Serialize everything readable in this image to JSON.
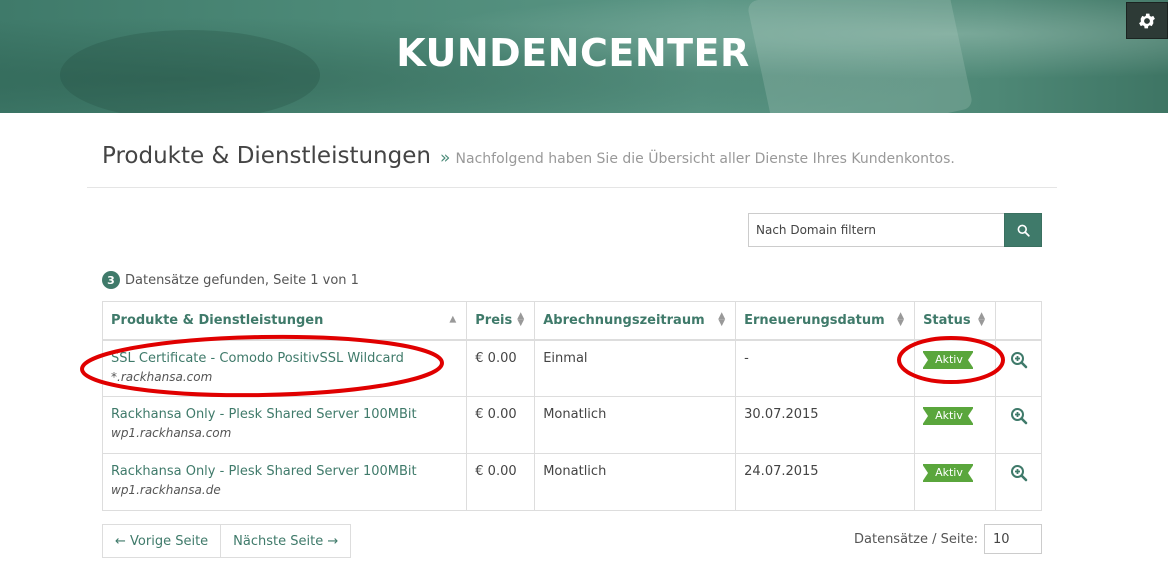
{
  "banner": {
    "title": "KUNDENCENTER"
  },
  "settings": {
    "icon": "gear-icon"
  },
  "page": {
    "title": "Produkte & Dienstleistungen",
    "separator": "»",
    "subtitle": "Nachfolgend haben Sie die Übersicht aller Dienste Ihres Kundenkontos."
  },
  "filter": {
    "placeholder": "Nach Domain filtern",
    "button_icon": "search-icon"
  },
  "records": {
    "count": "3",
    "text": "Datensätze gefunden, Seite 1 von 1"
  },
  "table": {
    "headers": [
      "Produkte & Dienstleistungen",
      "Preis",
      "Abrechnungszeitraum",
      "Erneuerungsdatum",
      "Status"
    ],
    "rows": [
      {
        "product": "SSL Certificate - Comodo PositivSSL Wildcard",
        "domain": "*.rackhansa.com",
        "price": "€ 0.00",
        "cycle": "Einmal",
        "renewal": "-",
        "status": "Aktiv"
      },
      {
        "product": "Rackhansa Only - Plesk Shared Server 100MBit",
        "domain": "wp1.rackhansa.com",
        "price": "€ 0.00",
        "cycle": "Monatlich",
        "renewal": "30.07.2015",
        "status": "Aktiv"
      },
      {
        "product": "Rackhansa Only - Plesk Shared Server 100MBit",
        "domain": "wp1.rackhansa.de",
        "price": "€ 0.00",
        "cycle": "Monatlich",
        "renewal": "24.07.2015",
        "status": "Aktiv"
      }
    ]
  },
  "pager": {
    "prev": "← Vorige Seite",
    "next": "Nächste Seite →"
  },
  "per_page": {
    "label": "Datensätze / Seite:",
    "value": "10"
  },
  "colors": {
    "accent": "#3f7a6a",
    "status_active": "#5aa63c",
    "annotation": "#e00000"
  }
}
